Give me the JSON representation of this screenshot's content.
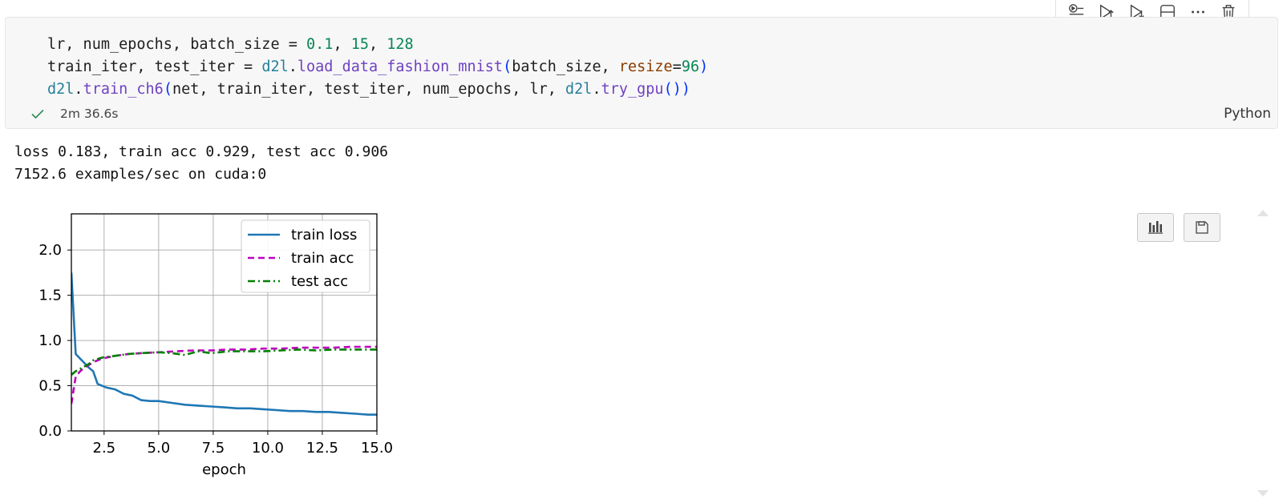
{
  "code": {
    "line1": {
      "a": "lr, num_epochs, batch_size = ",
      "n1": "0.1",
      "c1": ", ",
      "n2": "15",
      "c2": ", ",
      "n3": "128"
    },
    "line2": {
      "a": "train_iter, test_iter = ",
      "mod": "d2l",
      "dot": ".",
      "fn": "load_data_fashion_mnist",
      "p1": "(",
      "b": "batch_size, ",
      "param": "resize",
      "eq": "=",
      "n": "96",
      "p2": ")"
    },
    "line3": {
      "mod": "d2l",
      "dot": ".",
      "fn": "train_ch6",
      "p1": "(",
      "b": "net, train_iter, test_iter, num_epochs, lr, ",
      "mod2": "d2l",
      "dot2": ".",
      "fn2": "try_gpu",
      "p2": "())"
    }
  },
  "status": {
    "duration": "2m 36.6s",
    "language": "Python"
  },
  "output": {
    "line1": "loss 0.183, train acc 0.929, test acc 0.906",
    "line2": "7152.6 examples/sec on cuda:0"
  },
  "colors": {
    "train_loss": "#1f77b4",
    "train_acc": "#bf00bf",
    "test_acc": "#008000",
    "check": "#2e8b57"
  },
  "toolbar": [
    "run-by-line-icon",
    "execute-above-icon",
    "execute-below-icon",
    "split-cell-icon",
    "more-icon",
    "delete-icon"
  ],
  "chart_data": {
    "type": "line",
    "xlabel": "epoch",
    "xlim": [
      1,
      15
    ],
    "ylim": [
      0,
      2.4
    ],
    "xticks": [
      "2.5",
      "5.0",
      "7.5",
      "10.0",
      "12.5",
      "15.0"
    ],
    "yticks": [
      "0.0",
      "0.5",
      "1.0",
      "1.5",
      "2.0"
    ],
    "grid": true,
    "legend_position": "top-right",
    "series": [
      {
        "name": "train loss",
        "style": "solid",
        "x": [
          1.0,
          1.2,
          1.4,
          1.6,
          1.8,
          2.0,
          2.2,
          2.6,
          3.0,
          3.4,
          3.8,
          4.2,
          4.6,
          5.0,
          5.6,
          6.2,
          6.8,
          7.4,
          8.0,
          8.6,
          9.2,
          9.8,
          10.4,
          11.0,
          11.6,
          12.2,
          12.8,
          13.4,
          14.0,
          14.6,
          15.0
        ],
        "y": [
          1.75,
          0.85,
          0.8,
          0.75,
          0.7,
          0.66,
          0.52,
          0.48,
          0.46,
          0.41,
          0.39,
          0.34,
          0.33,
          0.33,
          0.31,
          0.29,
          0.28,
          0.27,
          0.26,
          0.25,
          0.25,
          0.24,
          0.23,
          0.22,
          0.22,
          0.21,
          0.21,
          0.2,
          0.19,
          0.18,
          0.18
        ]
      },
      {
        "name": "train acc",
        "style": "dashed",
        "x": [
          1.0,
          1.2,
          1.4,
          1.6,
          1.8,
          2.0,
          2.4,
          3.0,
          3.6,
          4.2,
          5.0,
          5.8,
          6.6,
          7.4,
          8.2,
          9.0,
          9.8,
          10.6,
          11.4,
          12.2,
          13.0,
          13.8,
          14.6,
          15.0
        ],
        "y": [
          0.3,
          0.6,
          0.66,
          0.7,
          0.73,
          0.76,
          0.8,
          0.83,
          0.85,
          0.86,
          0.87,
          0.88,
          0.89,
          0.89,
          0.9,
          0.9,
          0.91,
          0.91,
          0.92,
          0.92,
          0.92,
          0.93,
          0.93,
          0.93
        ]
      },
      {
        "name": "test acc",
        "style": "dashdot",
        "x": [
          1.0,
          1.2,
          1.5,
          1.8,
          2.0,
          2.4,
          3.0,
          3.6,
          4.2,
          5.0,
          5.6,
          6.2,
          6.8,
          7.4,
          8.2,
          9.0,
          9.8,
          10.6,
          11.4,
          12.2,
          13.0,
          13.8,
          14.6,
          15.0
        ],
        "y": [
          0.62,
          0.66,
          0.7,
          0.74,
          0.78,
          0.81,
          0.83,
          0.85,
          0.86,
          0.87,
          0.86,
          0.84,
          0.88,
          0.86,
          0.88,
          0.88,
          0.88,
          0.89,
          0.9,
          0.89,
          0.9,
          0.9,
          0.9,
          0.9
        ]
      }
    ]
  }
}
